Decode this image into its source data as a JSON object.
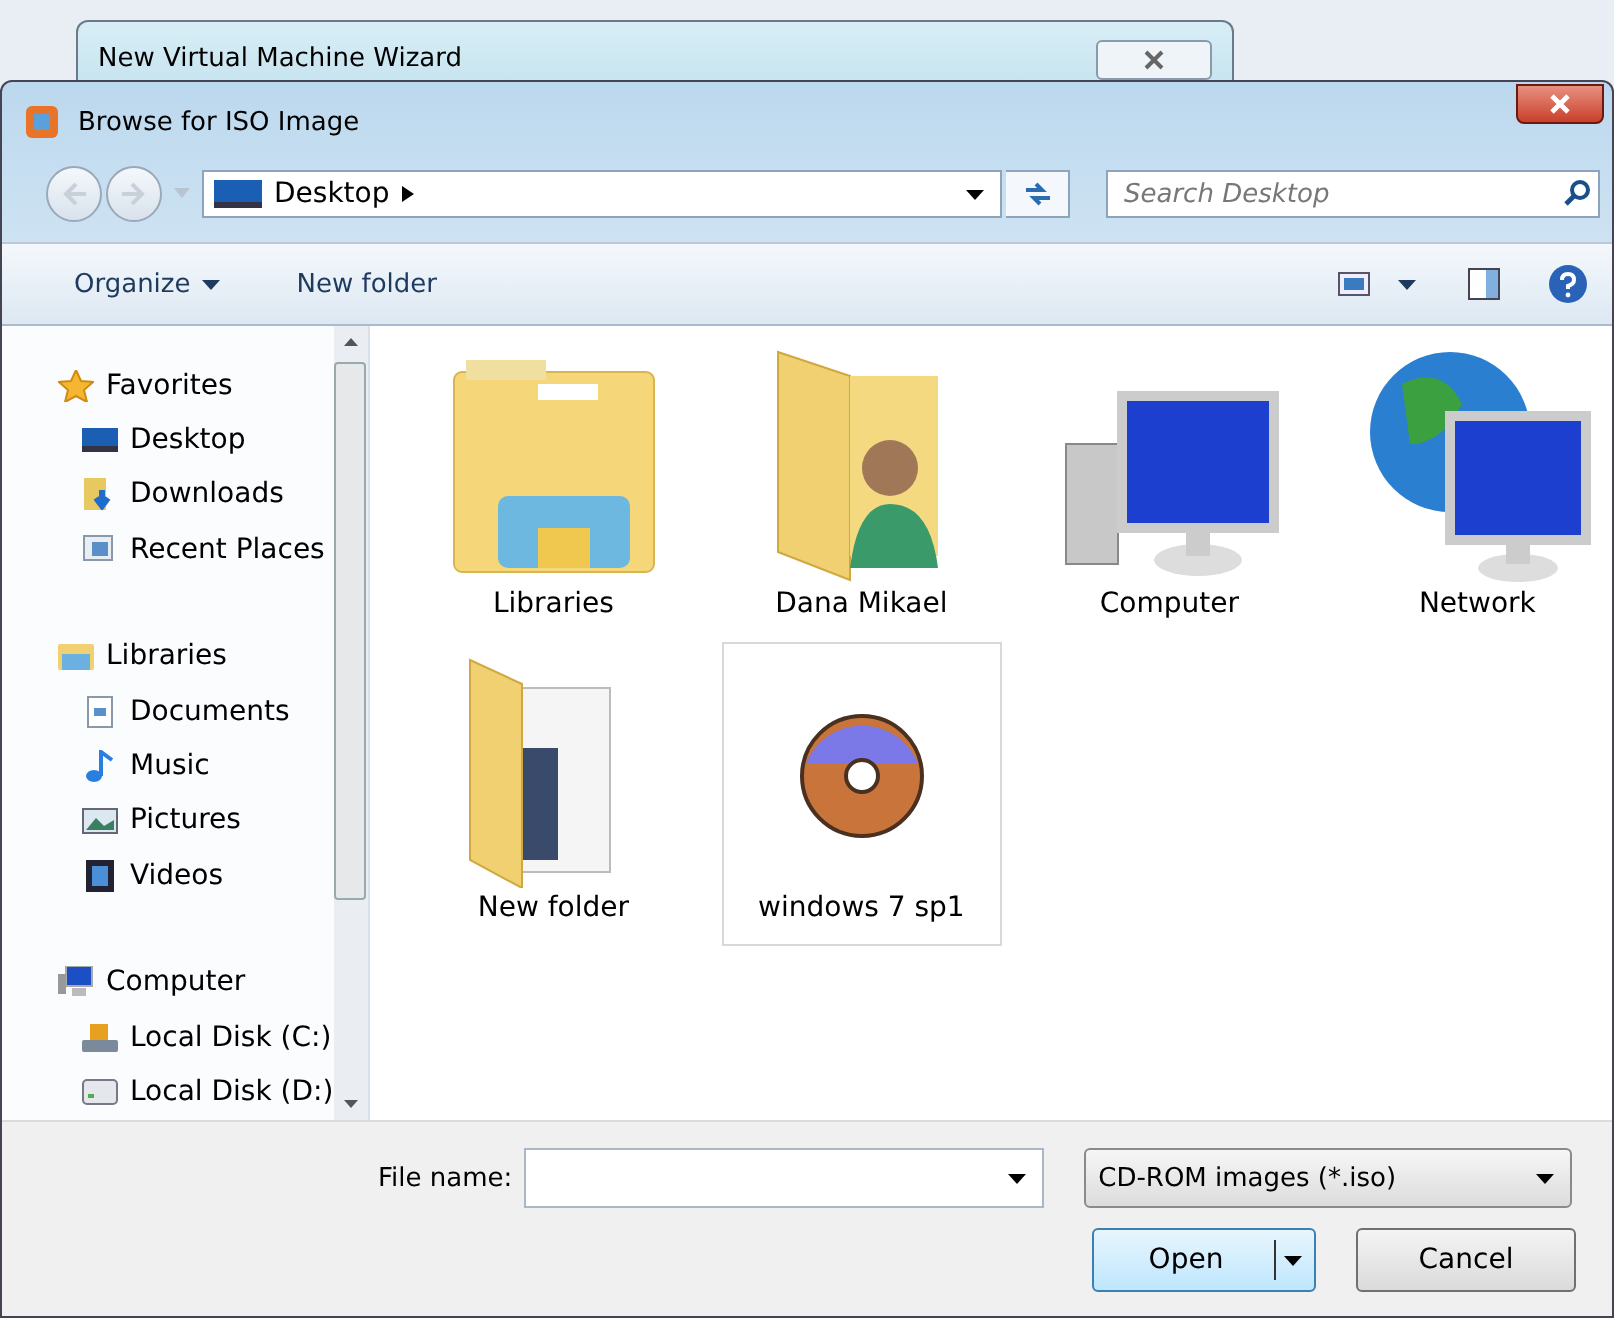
{
  "back_window": {
    "title": "New Virtual Machine Wizard"
  },
  "window": {
    "title": "Browse for ISO Image"
  },
  "address": {
    "location": "Desktop",
    "search_placeholder": "Search Desktop"
  },
  "toolbar": {
    "items": [
      {
        "label": "Organize",
        "kind": "menu"
      },
      {
        "label": "New folder",
        "kind": "plain"
      }
    ]
  },
  "nav": [
    {
      "label": "Favorites",
      "kind": "star",
      "children": [
        {
          "label": "Desktop",
          "kind": "desktop"
        },
        {
          "label": "Downloads",
          "kind": "downloads"
        },
        {
          "label": "Recent Places",
          "kind": "recent"
        }
      ]
    },
    {
      "label": "Libraries",
      "kind": "library",
      "children": [
        {
          "label": "Documents",
          "kind": "documents"
        },
        {
          "label": "Music",
          "kind": "music"
        },
        {
          "label": "Pictures",
          "kind": "pictures"
        },
        {
          "label": "Videos",
          "kind": "videos"
        }
      ]
    },
    {
      "label": "Computer",
      "kind": "computer",
      "children": [
        {
          "label": "Local Disk (C:)",
          "kind": "system-disk"
        },
        {
          "label": "Local Disk (D:)",
          "kind": "disk"
        }
      ]
    }
  ],
  "items": [
    {
      "label": "Libraries",
      "kind": "library",
      "selected": false
    },
    {
      "label": "Dana Mikael",
      "kind": "user",
      "selected": false
    },
    {
      "label": "Computer",
      "kind": "computer",
      "selected": false
    },
    {
      "label": "Network",
      "kind": "network",
      "selected": false
    },
    {
      "label": "New folder",
      "kind": "folder",
      "selected": false
    },
    {
      "label": "windows 7 sp1",
      "kind": "disc",
      "selected": true
    }
  ],
  "footer": {
    "file_name_label": "File name:",
    "file_type": "CD-ROM images (*.iso)",
    "buttons": [
      {
        "label": "Open",
        "kind": "split"
      },
      {
        "label": "Cancel",
        "kind": "plain"
      }
    ]
  }
}
